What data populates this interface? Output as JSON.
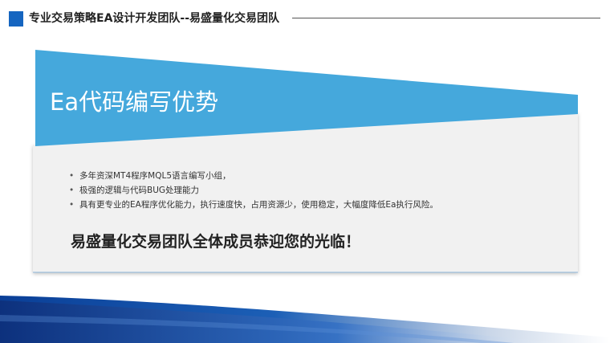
{
  "header": {
    "title": "专业交易策略EA设计开发团队--易盛量化交易团队"
  },
  "panel": {
    "heading": "Ea代码编写优势",
    "bullets": [
      "多年资深MT4程序MQL5语言编写小组，",
      "极强的逻辑与代码BUG处理能力",
      "具有更专业的EA程序优化能力，执行速度快，占用资源少，使用稳定，大幅度降低Ea执行风险。"
    ],
    "welcome": "易盛量化交易团队全体成员恭迎您的光临！"
  },
  "colors": {
    "accent_blue": "#45a8dc",
    "header_square": "#1565c0",
    "panel_bg": "#f1f1f1",
    "footer_blue": "#0d47a1"
  }
}
